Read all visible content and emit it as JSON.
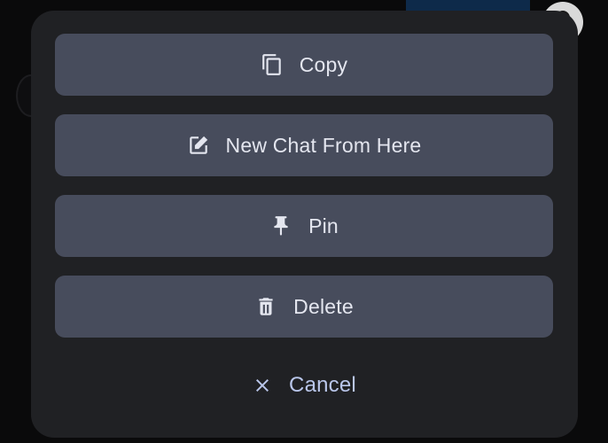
{
  "menu": {
    "actions": [
      {
        "label": "Copy",
        "icon": "copy-icon"
      },
      {
        "label": "New Chat From Here",
        "icon": "edit-icon"
      },
      {
        "label": "Pin",
        "icon": "pin-icon"
      },
      {
        "label": "Delete",
        "icon": "trash-icon"
      }
    ],
    "cancel": {
      "label": "Cancel",
      "icon": "close-icon"
    }
  },
  "colors": {
    "sheet": "#202124",
    "button": "#474c5c",
    "button_text": "#e4e6ef",
    "cancel_text": "#b9c6ea"
  }
}
